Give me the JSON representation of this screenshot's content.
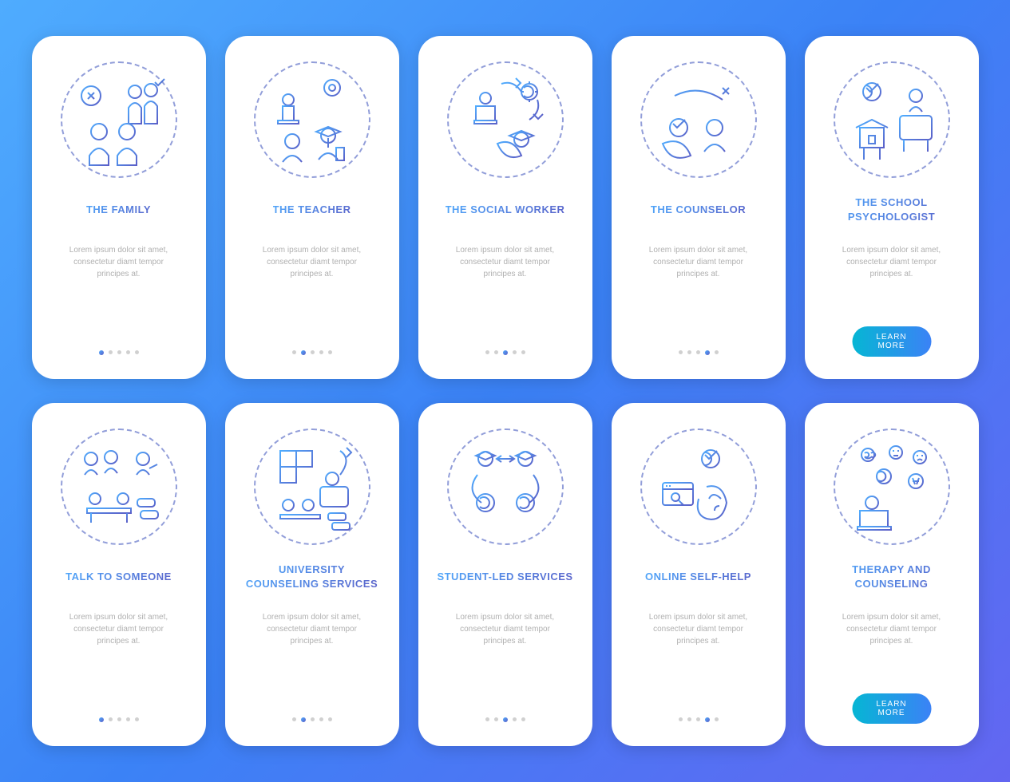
{
  "desc": "Lorem ipsum dolor sit amet, consectetur diamt tempor principes at.",
  "learn_more": "LEARN MORE",
  "rows": [
    {
      "cards": [
        {
          "title": "THE FAMILY",
          "icon": "family-icon",
          "active": 0
        },
        {
          "title": "THE TEACHER",
          "icon": "teacher-icon",
          "active": 1
        },
        {
          "title": "THE SOCIAL WORKER",
          "icon": "social-worker-icon",
          "active": 2
        },
        {
          "title": "THE COUNSELOR",
          "icon": "counselor-icon",
          "active": 3
        },
        {
          "title": "THE SCHOOL PSYCHOLOGIST",
          "icon": "psychologist-icon",
          "active": 4,
          "button": true
        }
      ]
    },
    {
      "cards": [
        {
          "title": "TALK TO SOMEONE",
          "icon": "talk-icon",
          "active": 0
        },
        {
          "title": "UNIVERSITY COUNSELING SERVICES",
          "icon": "university-icon",
          "active": 1
        },
        {
          "title": "STUDENT-LED SERVICES",
          "icon": "student-led-icon",
          "active": 2
        },
        {
          "title": "ONLINE SELF-HELP",
          "icon": "online-help-icon",
          "active": 3
        },
        {
          "title": "THERAPY AND COUNSELING",
          "icon": "therapy-icon",
          "active": 4,
          "button": true
        }
      ]
    }
  ]
}
